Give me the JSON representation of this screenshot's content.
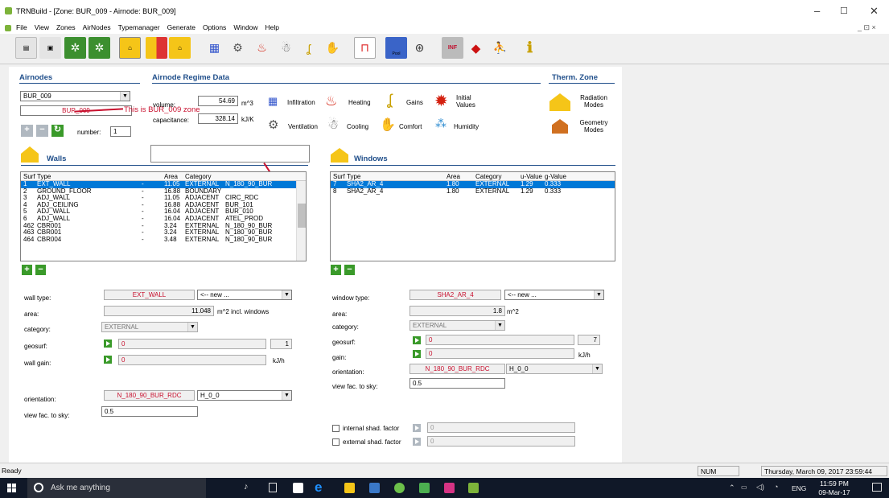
{
  "window": {
    "title": "TRNBuild - [Zone: BUR_009  -  Airnode: BUR_009]",
    "controls": [
      "–",
      "☐",
      "✕"
    ],
    "mdi_controls": "_  ⊡  ×"
  },
  "menu": [
    "File",
    "View",
    "Zones",
    "AirNodes",
    "Typemanager",
    "Generate",
    "Options",
    "Window",
    "Help"
  ],
  "toolbar": {
    "pool_label": "Pool",
    "inf_label": "INF"
  },
  "airnodes": {
    "header": "Airnodes",
    "selected": "BUR_009",
    "name_value": "BUR_009",
    "annotation": "This is BUR_009 zone",
    "number_label": "number:",
    "number_value": "1"
  },
  "regime": {
    "header": "Airnode Regime Data",
    "volume_label": "volume:",
    "volume_value": "54.69",
    "volume_unit": "m^3",
    "capacitance_label": "capacitance:",
    "capacitance_value": "328.14",
    "capacitance_unit": "kJ/K",
    "buttons": {
      "infiltration": "Infiltration",
      "heating": "Heating",
      "gains": "Gains",
      "initial_values": "Initial Values",
      "ventilation": "Ventilation",
      "cooling": "Cooling",
      "comfort": "Comfort",
      "humidity": "Humidity"
    }
  },
  "therm_zone": {
    "header": "Therm. Zone",
    "radiation_modes": "Radiation Modes",
    "geometry_modes": "Geometry Modes"
  },
  "walls": {
    "header": "Walls",
    "columns": [
      "Surf",
      "Type",
      "",
      "Area",
      "Category",
      ""
    ],
    "rows": [
      [
        "1",
        "EXT_WALL",
        "-",
        "11.05",
        "EXTERNAL",
        "N_180_90_BUR"
      ],
      [
        "2",
        "GROUND_FLOOR",
        "-",
        "16.88",
        "BOUNDARY",
        ""
      ],
      [
        "3",
        "ADJ_WALL",
        "-",
        "11.05",
        "ADJACENT",
        "CIRC_RDC"
      ],
      [
        "4",
        "ADJ_CEILING",
        "-",
        "16.88",
        "ADJACENT",
        "BUR_101"
      ],
      [
        "5",
        "ADJ_WALL",
        "-",
        "16.04",
        "ADJACENT",
        "BUR_010"
      ],
      [
        "6",
        "ADJ_WALL",
        "-",
        "16.04",
        "ADJACENT",
        "ATEL_PROD"
      ],
      [
        "462",
        "CBR001",
        "-",
        "3.24",
        "EXTERNAL",
        "N_180_90_BUR"
      ],
      [
        "463",
        "CBR001",
        "-",
        "3.24",
        "EXTERNAL",
        "N_180_90_BUR"
      ],
      [
        "464",
        "CBR004",
        "-",
        "3.48",
        "EXTERNAL",
        "N_180_90_BUR"
      ]
    ],
    "wall_type_label": "wall type:",
    "wall_type_value": "EXT_WALL",
    "wall_type_select": "<-- new ...",
    "area_label": "area:",
    "area_value": "11.048",
    "area_unit": "m^2   incl. windows",
    "category_label": "category:",
    "category_value": "EXTERNAL",
    "geosurf_label": "geosurf:",
    "geosurf_value": "0",
    "geosurf_right": "1",
    "gain_label": "wall gain:",
    "gain_value": "0",
    "gain_unit": "kJ/h",
    "orientation_label": "orientation:",
    "orientation_value": "N_180_90_BUR_RDC",
    "orientation_select": "H_0_0",
    "viewfac_label": "view fac. to sky:",
    "viewfac_value": "0.5"
  },
  "windows": {
    "header": "Windows",
    "columns": [
      "Surf",
      "Type",
      "Area",
      "Category",
      "u-Value",
      "g-Value"
    ],
    "rows": [
      [
        "7",
        "SHA2_AR_4",
        "1.80",
        "EXTERNAL",
        "1.29",
        "0.333"
      ],
      [
        "8",
        "SHA2_AR_4",
        "1.80",
        "EXTERNAL",
        "1.29",
        "0.333"
      ]
    ],
    "window_type_label": "window type:",
    "window_type_value": "SHA2_AR_4",
    "window_type_select": "<-- new ...",
    "area_label": "area:",
    "area_value": "1.8",
    "area_unit": "m^2",
    "category_label": "category:",
    "category_value": "EXTERNAL",
    "geosurf_label": "geosurf:",
    "geosurf_value": "0",
    "geosurf_right": "7",
    "gain_label": "gain:",
    "gain_value": "0",
    "gain_unit": "kJ/h",
    "orientation_label": "orientation:",
    "orientation_value": "N_180_90_BUR_RDC",
    "orientation_select": "H_0_0",
    "viewfac_label": "view fac. to sky:",
    "viewfac_value": "0.5",
    "internal_shad_label": "internal shad. factor",
    "internal_shad_value": "0",
    "external_shad_label": "external shad. factor",
    "external_shad_value": "0"
  },
  "status": {
    "ready": "Ready",
    "num": "NUM",
    "datetime": "Thursday, March 09, 2017   23:59:44"
  },
  "taskbar": {
    "search_placeholder": "Ask me anything",
    "time": "11:59 PM",
    "date": "09-Mar-17",
    "lang": "ENG"
  },
  "colors": {
    "accent_blue": "#1f4e8a",
    "selection": "#0078d7",
    "red_text": "#c8102e",
    "green_button": "#3a9a2a"
  }
}
